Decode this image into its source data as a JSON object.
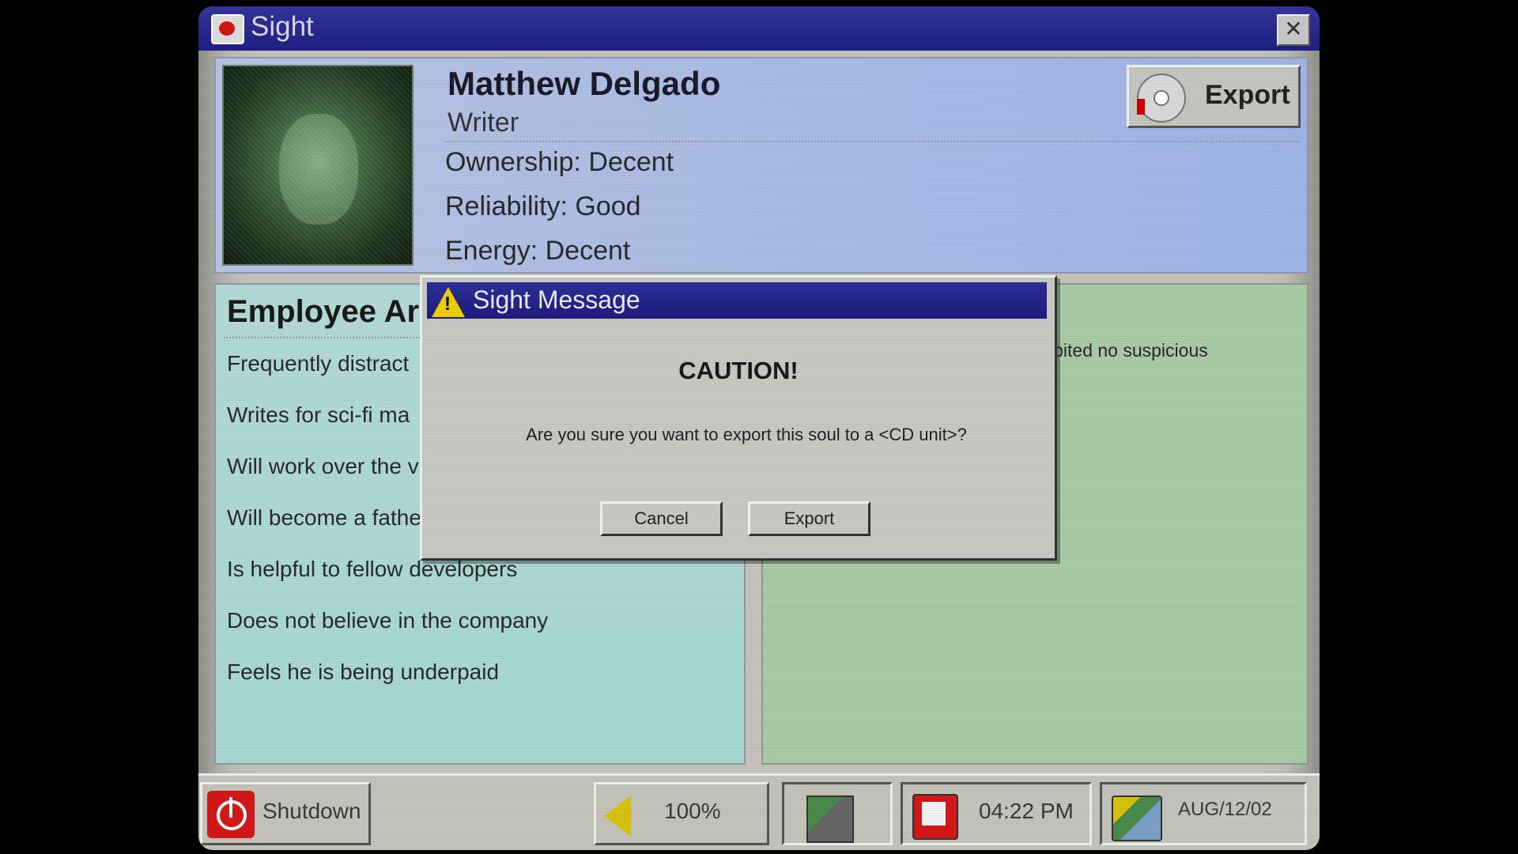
{
  "window": {
    "title": "Sight",
    "icon": "eye-icon",
    "close_glyph": "✕"
  },
  "profile": {
    "name": "Matthew Delgado",
    "role": "Writer",
    "stats": [
      "Ownership: Decent",
      "Reliability: Good",
      "Energy: Decent"
    ],
    "export_label": "Export",
    "export_icon": "cd-icon"
  },
  "notes": {
    "heading": "Employee Ar",
    "items": [
      "Frequently distract",
      "Writes for sci-fi ma",
      "Will work over the v",
      "Will become a fathe",
      "Is helpful to fellow developers",
      "Does not believe in the company",
      "Feels he is being underpaid"
    ]
  },
  "report": {
    "snippet": "ibited no suspicious"
  },
  "dialog": {
    "title": "Sight Message",
    "icon": "warning-icon",
    "heading": "CAUTION!",
    "message": "Are you sure you want to export this soul to a <CD unit>?",
    "cancel_label": "Cancel",
    "confirm_label": "Export"
  },
  "taskbar": {
    "shutdown_label": "Shutdown",
    "volume": "100%",
    "time": "04:22 PM",
    "date": "AUG/12/02"
  },
  "colors": {
    "titlebar": "#1f1f82",
    "profile_bg": "#a9bbe6",
    "notes_bg": "#aed9d6",
    "report_bg": "#a9cca7",
    "chrome": "#c4c4bc",
    "danger": "#d21818"
  }
}
